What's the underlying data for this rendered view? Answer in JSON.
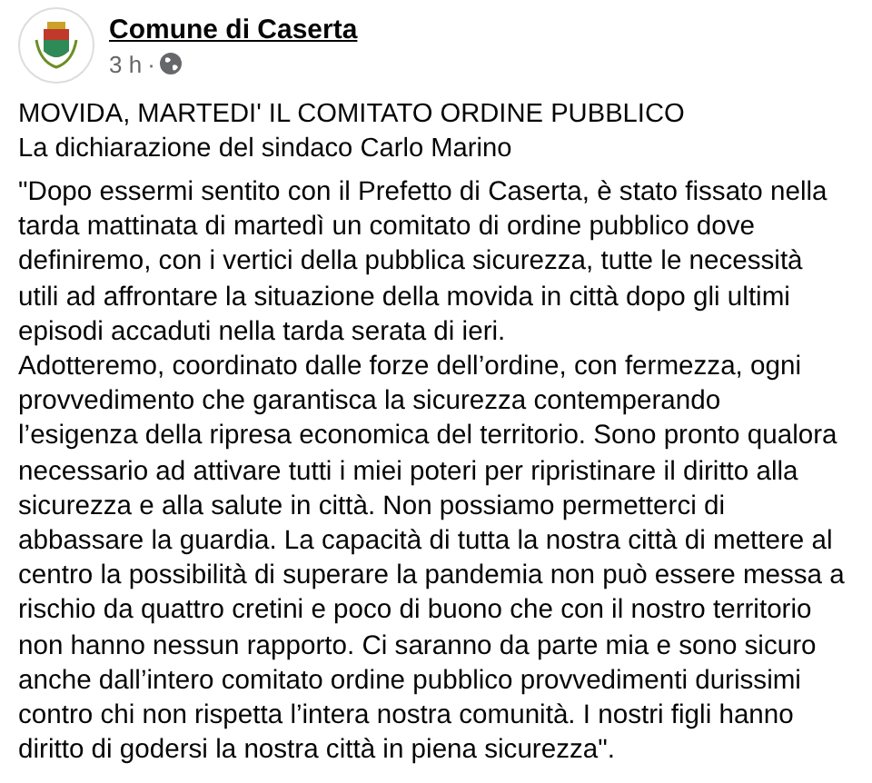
{
  "post": {
    "author": "Comune di Caserta",
    "time": "3 h",
    "separator": "·",
    "public": true,
    "headline": [
      "MOVIDA, MARTEDI' IL COMITATO ORDINE PUBBLICO",
      "La dichiarazione del sindaco Carlo Marino"
    ],
    "paragraphs": [
      "\"Dopo essermi sentito con il Prefetto di Caserta, è stato fissato nella tarda mattinata di martedì un comitato di ordine pubblico dove definiremo, con i vertici della pubblica sicurezza, tutte le necessità utili ad affrontare la situazione della movida in città dopo gli ultimi episodi accaduti nella tarda serata di ieri.",
      "Adotteremo, coordinato dalle forze dell’ordine, con fermezza, ogni provvedimento che garantisca la sicurezza contemperando l’esigenza della ripresa economica del territorio. Sono pronto qualora necessario ad attivare tutti i miei poteri per ripristinare il diritto alla sicurezza e alla salute in città. Non possiamo permetterci di abbassare la guardia. La capacità di tutta la nostra città di mettere al centro la possibilità di superare la pandemia non può essere messa a rischio da quattro cretini e poco di buono che con il nostro territorio  non hanno nessun rapporto. Ci saranno da parte mia e sono sicuro anche dall’intero comitato ordine pubblico provvedimenti durissimi contro chi non rispetta l’intera nostra comunità. I nostri figli hanno diritto di godersi la nostra città in piena sicurezza\"."
    ]
  }
}
